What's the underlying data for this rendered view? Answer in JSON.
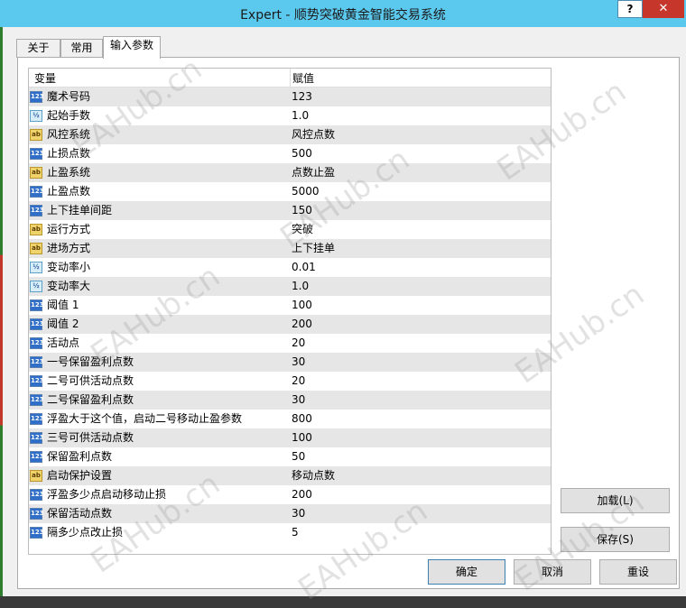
{
  "window": {
    "title": "Expert - 顺势突破黄金智能交易系统",
    "help_label": "?",
    "close_label": "✕"
  },
  "tabs": [
    {
      "label": "关于"
    },
    {
      "label": "常用"
    },
    {
      "label": "输入参数"
    }
  ],
  "grid": {
    "col_name": "变量",
    "col_value": "赋值",
    "rows": [
      {
        "type": "int",
        "name": "魔术号码",
        "value": "123"
      },
      {
        "type": "double",
        "name": "起始手数",
        "value": "1.0"
      },
      {
        "type": "string",
        "name": "风控系统",
        "value": " 风控点数"
      },
      {
        "type": "int",
        "name": "止损点数",
        "value": "500"
      },
      {
        "type": "string",
        "name": "止盈系统",
        "value": " 点数止盈"
      },
      {
        "type": "int",
        "name": "止盈点数",
        "value": "5000"
      },
      {
        "type": "int",
        "name": "上下挂单间距",
        "value": "150"
      },
      {
        "type": "string",
        "name": "运行方式",
        "value": "突破"
      },
      {
        "type": "string",
        "name": "进场方式",
        "value": "上下挂单"
      },
      {
        "type": "double",
        "name": "变动率小",
        "value": "0.01"
      },
      {
        "type": "double",
        "name": "变动率大",
        "value": "1.0"
      },
      {
        "type": "int",
        "name": "阈值 1",
        "value": "100"
      },
      {
        "type": "int",
        "name": "阈值 2",
        "value": "200"
      },
      {
        "type": "int",
        "name": "活动点",
        "value": "20"
      },
      {
        "type": "int",
        "name": "一号保留盈利点数",
        "value": "30"
      },
      {
        "type": "int",
        "name": "二号可供活动点数",
        "value": "20"
      },
      {
        "type": "int",
        "name": "二号保留盈利点数",
        "value": "30"
      },
      {
        "type": "int",
        "name": "浮盈大于这个值，启动二号移动止盈参数",
        "value": "800"
      },
      {
        "type": "int",
        "name": "三号可供活动点数",
        "value": "100"
      },
      {
        "type": "int",
        "name": "保留盈利点数",
        "value": "50"
      },
      {
        "type": "string",
        "name": "启动保护设置",
        "value": "移动点数"
      },
      {
        "type": "int",
        "name": "浮盈多少点启动移动止损",
        "value": "200"
      },
      {
        "type": "int",
        "name": "保留活动点数",
        "value": "30"
      },
      {
        "type": "int",
        "name": "隔多少点改止损",
        "value": "5"
      }
    ]
  },
  "type_icons": {
    "int": {
      "glyph": "123",
      "icon": "integer-type-icon"
    },
    "double": {
      "glyph": "½",
      "icon": "double-type-icon"
    },
    "string": {
      "glyph": "ab",
      "icon": "string-type-icon"
    }
  },
  "buttons": {
    "load": "加载(L)",
    "save": "保存(S)",
    "ok": "确定",
    "cancel": "取消",
    "reset": "重设"
  },
  "watermark": "EAHub.cn",
  "colors": {
    "titlebar": "#5bc8ee",
    "close": "#c7362b",
    "row_alt": "#e6e6e6"
  }
}
